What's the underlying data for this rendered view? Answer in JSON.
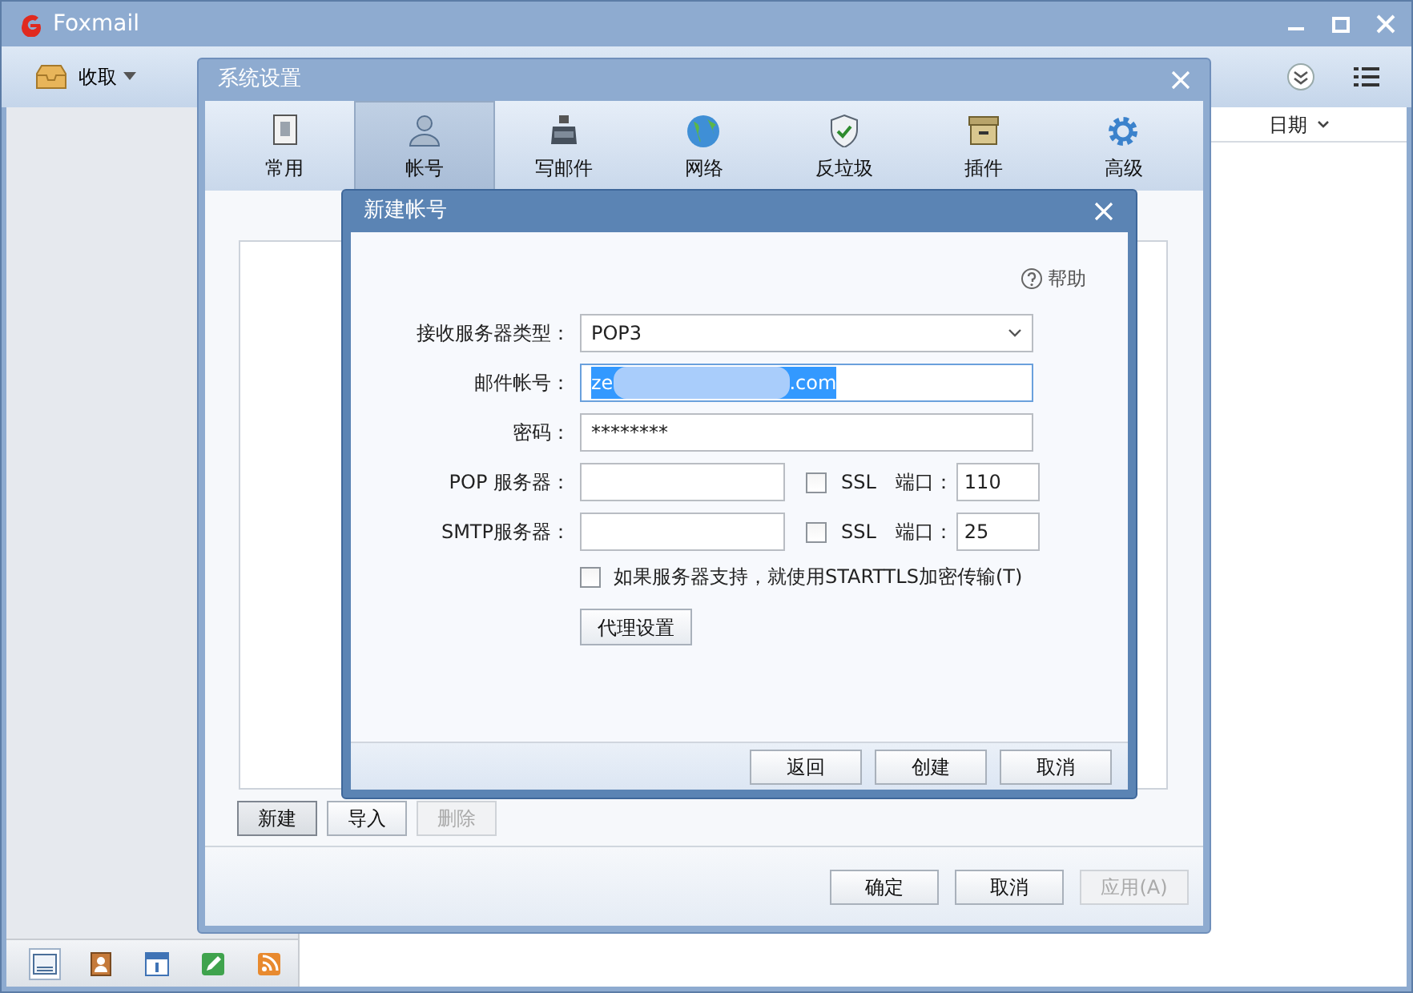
{
  "main_window": {
    "title": "Foxmail",
    "receive_button": "收取",
    "list_column": "日期",
    "nav_icons": [
      {
        "kind": "mail",
        "selected": true
      },
      {
        "kind": "contacts",
        "selected": false
      },
      {
        "kind": "calendar",
        "selected": false
      },
      {
        "kind": "notes",
        "selected": false
      },
      {
        "kind": "rss",
        "selected": false
      }
    ]
  },
  "settings_dialog": {
    "title": "系统设置",
    "tabs": [
      {
        "label": "常用",
        "kind": "general",
        "selected": false
      },
      {
        "label": "帐号",
        "kind": "account",
        "selected": true
      },
      {
        "label": "写邮件",
        "kind": "compose",
        "selected": false
      },
      {
        "label": "网络",
        "kind": "network",
        "selected": false
      },
      {
        "label": "反垃圾",
        "kind": "antispam",
        "selected": false
      },
      {
        "label": "插件",
        "kind": "plugin",
        "selected": false
      },
      {
        "label": "高级",
        "kind": "advanced",
        "selected": false
      }
    ],
    "account_buttons": [
      {
        "label": "新建",
        "disabled": false
      },
      {
        "label": "导入",
        "disabled": false
      },
      {
        "label": "删除",
        "disabled": true
      }
    ],
    "footer_buttons": [
      {
        "label": "确定",
        "disabled": false
      },
      {
        "label": "取消",
        "disabled": false
      },
      {
        "label": "应用(A)",
        "disabled": true
      }
    ]
  },
  "new_account_dialog": {
    "title": "新建帐号",
    "help": "帮助",
    "server_type": {
      "label": "接收服务器类型：",
      "value": "POP3"
    },
    "email": {
      "label": "邮件帐号：",
      "value_start": "ze",
      "value_end": ".com",
      "redacted": true,
      "selected": true
    },
    "password": {
      "label": "密码：",
      "value": "********"
    },
    "servers": [
      {
        "label": "POP 服务器：",
        "ssl_label": "SSL",
        "ssl_checked": false,
        "port_label": "端口：",
        "port": "110"
      },
      {
        "label": "SMTP服务器：",
        "ssl_label": "SSL",
        "ssl_checked": false,
        "port_label": "端口：",
        "port": "25"
      }
    ],
    "starttls": {
      "label": "如果服务器支持，就使用STARTTLS加密传输(T)",
      "checked": false
    },
    "proxy_button": "代理设置",
    "buttons": [
      "返回",
      "创建",
      "取消"
    ]
  }
}
